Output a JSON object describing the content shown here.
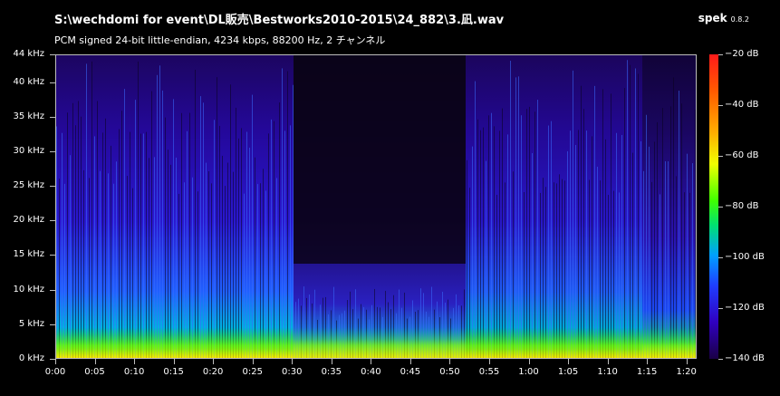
{
  "file_title": "S:\\wechdomi for event\\DL販売\\Bestworks2010-2015\\24_882\\3.凪.wav",
  "format_info": "PCM signed 24-bit little-endian, 4234 kbps, 88200 Hz, 2 チャンネル",
  "app_name": "spek",
  "app_version": "0.8.2",
  "freq_axis": {
    "labels": [
      "0 kHz",
      "5 kHz",
      "10 kHz",
      "15 kHz",
      "20 kHz",
      "25 kHz",
      "30 kHz",
      "35 kHz",
      "40 kHz",
      "44 kHz"
    ],
    "values": [
      0,
      5,
      10,
      15,
      20,
      25,
      30,
      35,
      40,
      44
    ],
    "max": 44
  },
  "time_axis": {
    "labels": [
      "0:00",
      "0:05",
      "0:10",
      "0:15",
      "0:20",
      "0:25",
      "0:30",
      "0:35",
      "0:40",
      "0:45",
      "0:50",
      "0:55",
      "1:00",
      "1:05",
      "1:10",
      "1:15",
      "1:20"
    ],
    "seconds": [
      0,
      5,
      10,
      15,
      20,
      25,
      30,
      35,
      40,
      45,
      50,
      55,
      60,
      65,
      70,
      75,
      80
    ],
    "duration_seconds": 81.3
  },
  "level_scale": {
    "labels": [
      "−20 dB",
      "−40 dB",
      "−60 dB",
      "−80 dB",
      "−100 dB",
      "−120 dB",
      "−140 dB"
    ],
    "values": [
      -20,
      -40,
      -60,
      -80,
      -100,
      -120,
      -140
    ]
  }
}
